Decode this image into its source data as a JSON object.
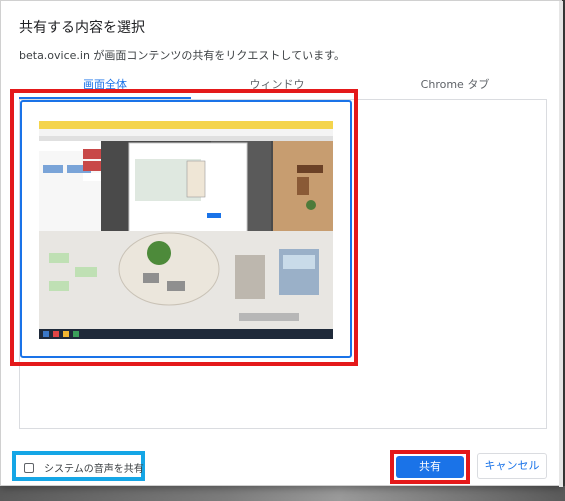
{
  "dialog": {
    "title": "共有する内容を選択",
    "subtitle": "beta.ovice.in が画面コンテンツの共有をリクエストしています。"
  },
  "tabs": [
    {
      "label": "画面全体",
      "active": true
    },
    {
      "label": "ウィンドウ",
      "active": false
    },
    {
      "label": "Chrome タブ",
      "active": false
    }
  ],
  "audio": {
    "label": "システムの音声を共有",
    "checked": false
  },
  "buttons": {
    "share": "共有",
    "cancel": "キャンセル"
  },
  "colors": {
    "accent": "#1a73e8",
    "highlight_red": "#e4191a",
    "highlight_cyan": "#15a6e6"
  },
  "thumbnail": {
    "icon": "screen-preview-thumbnail"
  }
}
